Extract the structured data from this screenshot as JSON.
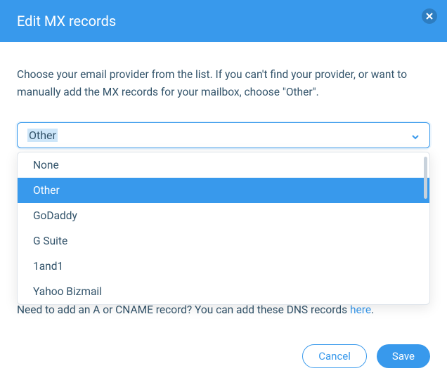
{
  "header": {
    "title": "Edit MX records"
  },
  "body": {
    "description": "Choose your email provider from the list. If you can't find your provider, or want to manually add the MX records for your mailbox, choose \"Other\"."
  },
  "select": {
    "value": "Other",
    "options": [
      "None",
      "Other",
      "GoDaddy",
      "G Suite",
      "1and1",
      "Yahoo Bizmail"
    ],
    "selected_index": 1
  },
  "footer": {
    "text_prefix": "Need to add an A or CNAME record? You can add these DNS records ",
    "link_text": "here",
    "text_suffix": "."
  },
  "buttons": {
    "cancel": "Cancel",
    "save": "Save"
  }
}
